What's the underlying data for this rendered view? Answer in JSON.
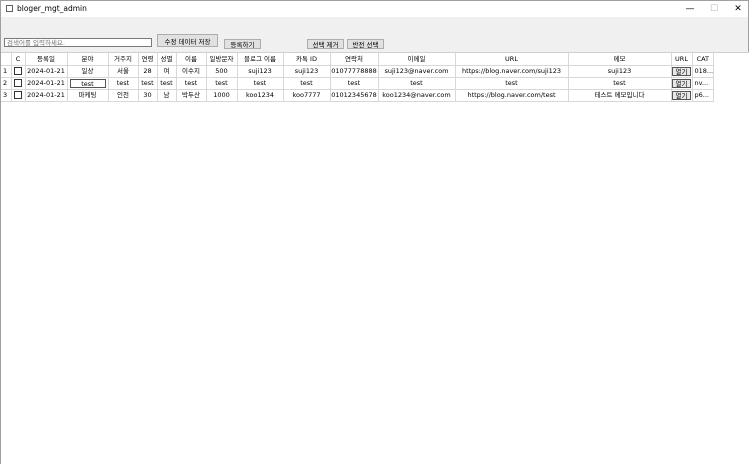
{
  "window": {
    "title": "bloger_mgt_admin",
    "min": "—",
    "max": "☐",
    "close": "✕"
  },
  "toolbar": {
    "search_placeholder": "검색어를 입력하세요.",
    "save_label": "수정 데이터 저장",
    "register_label": "등록하기",
    "remove_label": "선택 제거",
    "invert_label": "반전 선택"
  },
  "table": {
    "columns": [
      "",
      "C",
      "등록일",
      "분야",
      "거주지",
      "연령",
      "성별",
      "이름",
      "일방문자",
      "블로그 이름",
      "카톡 ID",
      "연락처",
      "이메일",
      "URL",
      "메모",
      "URL",
      "CAT"
    ],
    "rows": [
      {
        "num": "1",
        "date": "2024-01-21",
        "field": "일상",
        "region": "서울",
        "age": "28",
        "gender": "여",
        "name": "이수지",
        "visitors": "500",
        "blog": "suji123",
        "kakao": "suji123",
        "phone": "01077778888",
        "email": "suji123@naver.com",
        "url": "https://blog.naver.com/suji123",
        "memo": "suji123",
        "open": "열기",
        "cat": "018..."
      },
      {
        "num": "2",
        "date": "2024-01-21",
        "field": "test",
        "region": "test",
        "age": "test",
        "gender": "test",
        "name": "test",
        "visitors": "test",
        "blog": "test",
        "kakao": "test",
        "phone": "test",
        "email": "test",
        "url": "test",
        "memo": "test",
        "open": "열기",
        "cat": "nv..."
      },
      {
        "num": "3",
        "date": "2024-01-21",
        "field": "마케팅",
        "region": "인천",
        "age": "30",
        "gender": "남",
        "name": "박두산",
        "visitors": "1000",
        "blog": "koo1234",
        "kakao": "koo7777",
        "phone": "01012345678",
        "email": "koo1234@naver.com",
        "url": "https://blog.naver.com/test",
        "memo": "테스트 메모입니다",
        "open": "열기",
        "cat": "p6..."
      }
    ]
  }
}
